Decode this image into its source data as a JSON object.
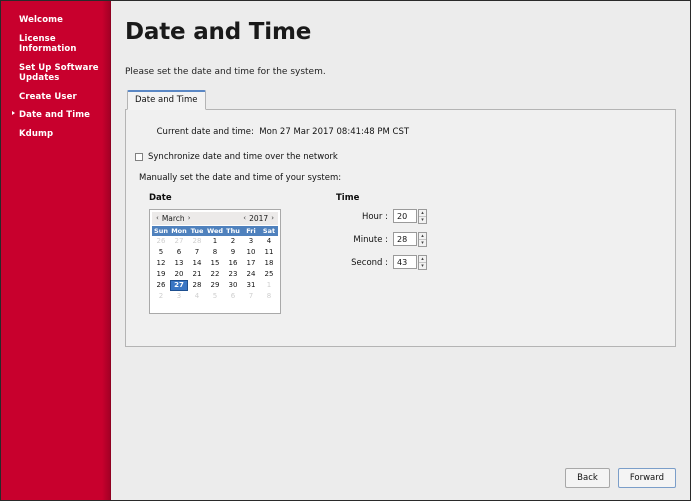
{
  "sidebar": {
    "items": [
      {
        "label": "Welcome",
        "active": false
      },
      {
        "label": "License\nInformation",
        "active": false
      },
      {
        "label": "Set Up Software\nUpdates",
        "active": false
      },
      {
        "label": "Create User",
        "active": false
      },
      {
        "label": "Date and Time",
        "active": true
      },
      {
        "label": "Kdump",
        "active": false
      }
    ],
    "accent_color": "#c8002d"
  },
  "header": {
    "title": "Date and Time",
    "subtitle": "Please set the date and time for the system."
  },
  "tabs": [
    {
      "label": "Date and Time",
      "selected": true
    }
  ],
  "panel": {
    "current_label": "Current date and time:",
    "current_value": "Mon 27 Mar 2017 08:41:48 PM CST",
    "sync_checkbox_label": "Synchronize date and time over the network",
    "sync_checked": false,
    "manual_label": "Manually set the date and time of your system:"
  },
  "date_section": {
    "heading": "Date",
    "prev_month_icon": "chevron-left-icon",
    "next_month_icon": "chevron-right-icon",
    "prev_year_icon": "chevron-left-icon",
    "next_year_icon": "chevron-right-icon",
    "prev_arrow": "‹",
    "next_arrow": "›",
    "month": "March",
    "year": "2017",
    "weekdays": [
      "Sun",
      "Mon",
      "Tue",
      "Wed",
      "Thu",
      "Fri",
      "Sat"
    ],
    "selected_day": 27,
    "weeks": [
      [
        {
          "d": "26",
          "other": true
        },
        {
          "d": "27",
          "other": true
        },
        {
          "d": "28",
          "other": true
        },
        {
          "d": "1"
        },
        {
          "d": "2"
        },
        {
          "d": "3"
        },
        {
          "d": "4"
        }
      ],
      [
        {
          "d": "5"
        },
        {
          "d": "6"
        },
        {
          "d": "7"
        },
        {
          "d": "8"
        },
        {
          "d": "9"
        },
        {
          "d": "10"
        },
        {
          "d": "11"
        }
      ],
      [
        {
          "d": "12"
        },
        {
          "d": "13"
        },
        {
          "d": "14"
        },
        {
          "d": "15"
        },
        {
          "d": "16"
        },
        {
          "d": "17"
        },
        {
          "d": "18"
        }
      ],
      [
        {
          "d": "19"
        },
        {
          "d": "20"
        },
        {
          "d": "21"
        },
        {
          "d": "22"
        },
        {
          "d": "23"
        },
        {
          "d": "24"
        },
        {
          "d": "25"
        }
      ],
      [
        {
          "d": "26"
        },
        {
          "d": "27",
          "sel": true
        },
        {
          "d": "28"
        },
        {
          "d": "29"
        },
        {
          "d": "30"
        },
        {
          "d": "31"
        },
        {
          "d": "1",
          "other": true
        }
      ],
      [
        {
          "d": "2",
          "other": true
        },
        {
          "d": "3",
          "other": true
        },
        {
          "d": "4",
          "other": true
        },
        {
          "d": "5",
          "other": true
        },
        {
          "d": "6",
          "other": true
        },
        {
          "d": "7",
          "other": true
        },
        {
          "d": "8",
          "other": true
        }
      ]
    ],
    "header_bg": "#eceae9",
    "weekday_bg": "#4f81bd",
    "selected_bg": "#3a76c4"
  },
  "time_section": {
    "heading": "Time",
    "fields": [
      {
        "label": "Hour :",
        "value": "20"
      },
      {
        "label": "Minute :",
        "value": "28"
      },
      {
        "label": "Second :",
        "value": "43"
      }
    ],
    "up_arrow": "▴",
    "down_arrow": "▾"
  },
  "footer": {
    "back_label": "Back",
    "forward_label": "Forward"
  }
}
